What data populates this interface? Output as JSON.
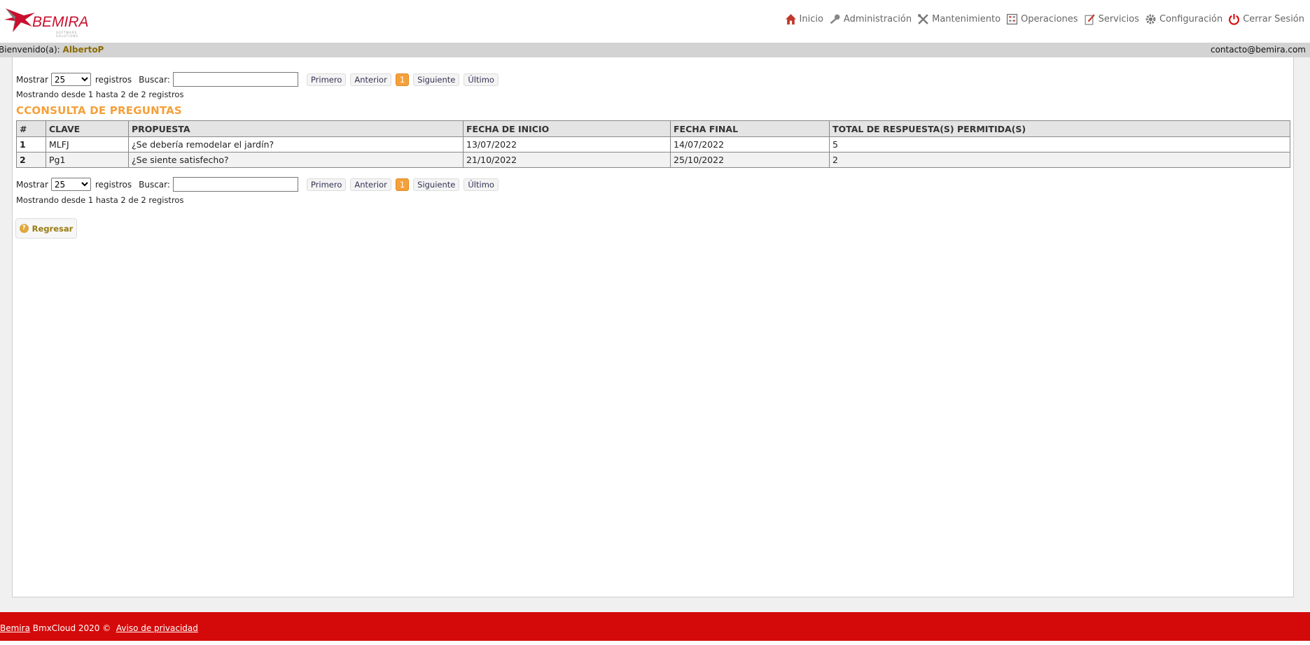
{
  "brand": {
    "name": "BEMIRA",
    "tagline": "SOFTWARE SOLUTIONS",
    "accent": "#c8102e"
  },
  "nav": [
    {
      "label": "Inicio",
      "icon": "home-icon"
    },
    {
      "label": "Administración",
      "icon": "key-icon"
    },
    {
      "label": "Mantenimiento",
      "icon": "tools-icon"
    },
    {
      "label": "Operaciones",
      "icon": "calculator-icon"
    },
    {
      "label": "Servicios",
      "icon": "edit-icon"
    },
    {
      "label": "Configuración",
      "icon": "gear-icon"
    },
    {
      "label": "Cerrar Sesión",
      "icon": "power-icon"
    }
  ],
  "welcome": {
    "prefix": "Bienvenido(a):",
    "user": "AlbertoP",
    "contact": "contacto@bemira.com"
  },
  "paging": {
    "show_label": "Mostrar",
    "page_size": "25",
    "page_size_options": [
      "25"
    ],
    "records_label": "registros",
    "search_label": "Buscar:",
    "search_value": "",
    "first": "Primero",
    "prev": "Anterior",
    "current_page": "1",
    "next": "Siguiente",
    "last": "Último",
    "info": "Mostrando desde 1 hasta 2 de 2 registros"
  },
  "page_title": "CCONSULTA DE PREGUNTAS",
  "table": {
    "headers": [
      "#",
      "CLAVE",
      "PROPUESTA",
      "FECHA DE INICIO",
      "FECHA FINAL",
      "TOTAL DE RESPUESTA(S) PERMITIDA(S)"
    ],
    "rows": [
      [
        "1",
        "MLFJ",
        "¿Se debería remodelar el jardín?",
        "13/07/2022",
        "14/07/2022",
        "5"
      ],
      [
        "2",
        "Pg1",
        "¿Se siente satisfecho?",
        "21/10/2022",
        "25/10/2022",
        "2"
      ]
    ]
  },
  "back_button": {
    "label": "Regresar",
    "icon": "question-icon"
  },
  "footer": {
    "brand_link": "Bemira",
    "text": "BmxCloud 2020 ©",
    "privacy_link": "Aviso de privacidad"
  },
  "colors": {
    "footer": "#d40a0a",
    "title": "#f5a03a",
    "welcome_bar": "#d3d3d3"
  }
}
